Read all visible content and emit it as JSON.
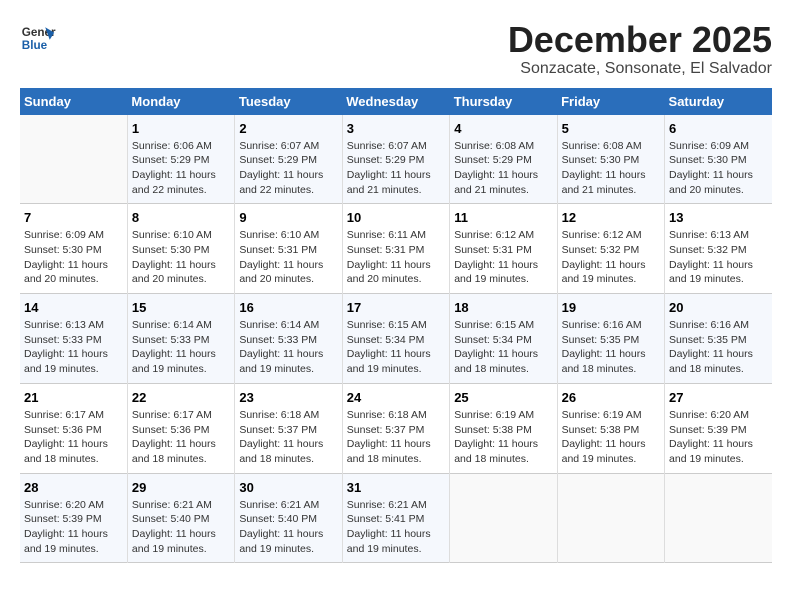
{
  "logo": {
    "line1": "General",
    "line2": "Blue"
  },
  "title": "December 2025",
  "subtitle": "Sonzacate, Sonsonate, El Salvador",
  "weekdays": [
    "Sunday",
    "Monday",
    "Tuesday",
    "Wednesday",
    "Thursday",
    "Friday",
    "Saturday"
  ],
  "weeks": [
    [
      {
        "day": "",
        "sunrise": "",
        "sunset": "",
        "daylight": ""
      },
      {
        "day": "1",
        "sunrise": "Sunrise: 6:06 AM",
        "sunset": "Sunset: 5:29 PM",
        "daylight": "Daylight: 11 hours and 22 minutes."
      },
      {
        "day": "2",
        "sunrise": "Sunrise: 6:07 AM",
        "sunset": "Sunset: 5:29 PM",
        "daylight": "Daylight: 11 hours and 22 minutes."
      },
      {
        "day": "3",
        "sunrise": "Sunrise: 6:07 AM",
        "sunset": "Sunset: 5:29 PM",
        "daylight": "Daylight: 11 hours and 21 minutes."
      },
      {
        "day": "4",
        "sunrise": "Sunrise: 6:08 AM",
        "sunset": "Sunset: 5:29 PM",
        "daylight": "Daylight: 11 hours and 21 minutes."
      },
      {
        "day": "5",
        "sunrise": "Sunrise: 6:08 AM",
        "sunset": "Sunset: 5:30 PM",
        "daylight": "Daylight: 11 hours and 21 minutes."
      },
      {
        "day": "6",
        "sunrise": "Sunrise: 6:09 AM",
        "sunset": "Sunset: 5:30 PM",
        "daylight": "Daylight: 11 hours and 20 minutes."
      }
    ],
    [
      {
        "day": "7",
        "sunrise": "Sunrise: 6:09 AM",
        "sunset": "Sunset: 5:30 PM",
        "daylight": "Daylight: 11 hours and 20 minutes."
      },
      {
        "day": "8",
        "sunrise": "Sunrise: 6:10 AM",
        "sunset": "Sunset: 5:30 PM",
        "daylight": "Daylight: 11 hours and 20 minutes."
      },
      {
        "day": "9",
        "sunrise": "Sunrise: 6:10 AM",
        "sunset": "Sunset: 5:31 PM",
        "daylight": "Daylight: 11 hours and 20 minutes."
      },
      {
        "day": "10",
        "sunrise": "Sunrise: 6:11 AM",
        "sunset": "Sunset: 5:31 PM",
        "daylight": "Daylight: 11 hours and 20 minutes."
      },
      {
        "day": "11",
        "sunrise": "Sunrise: 6:12 AM",
        "sunset": "Sunset: 5:31 PM",
        "daylight": "Daylight: 11 hours and 19 minutes."
      },
      {
        "day": "12",
        "sunrise": "Sunrise: 6:12 AM",
        "sunset": "Sunset: 5:32 PM",
        "daylight": "Daylight: 11 hours and 19 minutes."
      },
      {
        "day": "13",
        "sunrise": "Sunrise: 6:13 AM",
        "sunset": "Sunset: 5:32 PM",
        "daylight": "Daylight: 11 hours and 19 minutes."
      }
    ],
    [
      {
        "day": "14",
        "sunrise": "Sunrise: 6:13 AM",
        "sunset": "Sunset: 5:33 PM",
        "daylight": "Daylight: 11 hours and 19 minutes."
      },
      {
        "day": "15",
        "sunrise": "Sunrise: 6:14 AM",
        "sunset": "Sunset: 5:33 PM",
        "daylight": "Daylight: 11 hours and 19 minutes."
      },
      {
        "day": "16",
        "sunrise": "Sunrise: 6:14 AM",
        "sunset": "Sunset: 5:33 PM",
        "daylight": "Daylight: 11 hours and 19 minutes."
      },
      {
        "day": "17",
        "sunrise": "Sunrise: 6:15 AM",
        "sunset": "Sunset: 5:34 PM",
        "daylight": "Daylight: 11 hours and 19 minutes."
      },
      {
        "day": "18",
        "sunrise": "Sunrise: 6:15 AM",
        "sunset": "Sunset: 5:34 PM",
        "daylight": "Daylight: 11 hours and 18 minutes."
      },
      {
        "day": "19",
        "sunrise": "Sunrise: 6:16 AM",
        "sunset": "Sunset: 5:35 PM",
        "daylight": "Daylight: 11 hours and 18 minutes."
      },
      {
        "day": "20",
        "sunrise": "Sunrise: 6:16 AM",
        "sunset": "Sunset: 5:35 PM",
        "daylight": "Daylight: 11 hours and 18 minutes."
      }
    ],
    [
      {
        "day": "21",
        "sunrise": "Sunrise: 6:17 AM",
        "sunset": "Sunset: 5:36 PM",
        "daylight": "Daylight: 11 hours and 18 minutes."
      },
      {
        "day": "22",
        "sunrise": "Sunrise: 6:17 AM",
        "sunset": "Sunset: 5:36 PM",
        "daylight": "Daylight: 11 hours and 18 minutes."
      },
      {
        "day": "23",
        "sunrise": "Sunrise: 6:18 AM",
        "sunset": "Sunset: 5:37 PM",
        "daylight": "Daylight: 11 hours and 18 minutes."
      },
      {
        "day": "24",
        "sunrise": "Sunrise: 6:18 AM",
        "sunset": "Sunset: 5:37 PM",
        "daylight": "Daylight: 11 hours and 18 minutes."
      },
      {
        "day": "25",
        "sunrise": "Sunrise: 6:19 AM",
        "sunset": "Sunset: 5:38 PM",
        "daylight": "Daylight: 11 hours and 18 minutes."
      },
      {
        "day": "26",
        "sunrise": "Sunrise: 6:19 AM",
        "sunset": "Sunset: 5:38 PM",
        "daylight": "Daylight: 11 hours and 19 minutes."
      },
      {
        "day": "27",
        "sunrise": "Sunrise: 6:20 AM",
        "sunset": "Sunset: 5:39 PM",
        "daylight": "Daylight: 11 hours and 19 minutes."
      }
    ],
    [
      {
        "day": "28",
        "sunrise": "Sunrise: 6:20 AM",
        "sunset": "Sunset: 5:39 PM",
        "daylight": "Daylight: 11 hours and 19 minutes."
      },
      {
        "day": "29",
        "sunrise": "Sunrise: 6:21 AM",
        "sunset": "Sunset: 5:40 PM",
        "daylight": "Daylight: 11 hours and 19 minutes."
      },
      {
        "day": "30",
        "sunrise": "Sunrise: 6:21 AM",
        "sunset": "Sunset: 5:40 PM",
        "daylight": "Daylight: 11 hours and 19 minutes."
      },
      {
        "day": "31",
        "sunrise": "Sunrise: 6:21 AM",
        "sunset": "Sunset: 5:41 PM",
        "daylight": "Daylight: 11 hours and 19 minutes."
      },
      {
        "day": "",
        "sunrise": "",
        "sunset": "",
        "daylight": ""
      },
      {
        "day": "",
        "sunrise": "",
        "sunset": "",
        "daylight": ""
      },
      {
        "day": "",
        "sunrise": "",
        "sunset": "",
        "daylight": ""
      }
    ]
  ]
}
